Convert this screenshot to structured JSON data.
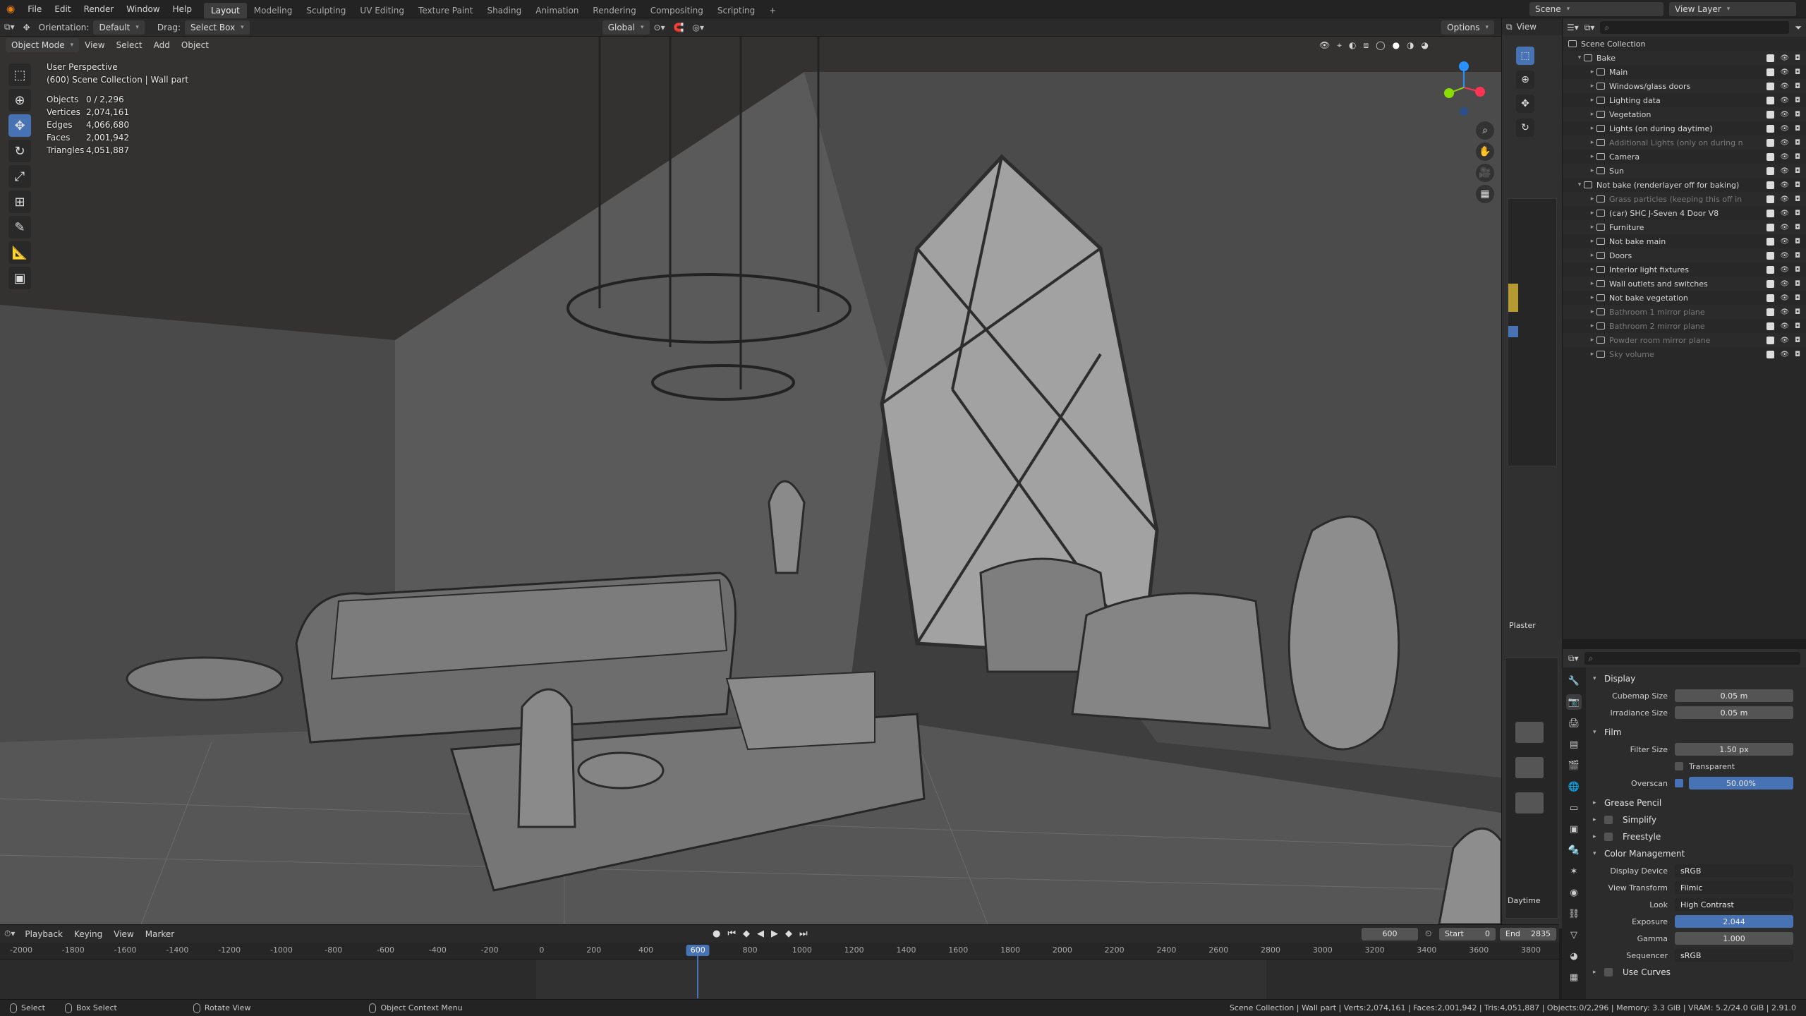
{
  "menubar": {
    "menus": [
      "File",
      "Edit",
      "Render",
      "Window",
      "Help"
    ],
    "workspaces": [
      {
        "label": "Layout",
        "active": true
      },
      {
        "label": "Modeling"
      },
      {
        "label": "Sculpting"
      },
      {
        "label": "UV Editing"
      },
      {
        "label": "Texture Paint"
      },
      {
        "label": "Shading"
      },
      {
        "label": "Animation"
      },
      {
        "label": "Rendering"
      },
      {
        "label": "Compositing"
      },
      {
        "label": "Scripting"
      }
    ],
    "add_workspace": "+",
    "scene": "Scene",
    "view_layer": "View Layer"
  },
  "viewport_header": {
    "orientation_label": "Orientation:",
    "orientation_value": "Default",
    "drag_label": "Drag:",
    "drag_value": "Select Box",
    "transform_orientation": "Global",
    "options": "Options",
    "mode": "Object Mode",
    "menus": [
      "View",
      "Select",
      "Add",
      "Object"
    ]
  },
  "viewport": {
    "perspective": "User Perspective",
    "collection_path": "(600) Scene Collection | Wall part",
    "stats": [
      {
        "label": "Objects",
        "value": "0 / 2,296"
      },
      {
        "label": "Vertices",
        "value": "2,074,161"
      },
      {
        "label": "Edges",
        "value": "4,066,680"
      },
      {
        "label": "Faces",
        "value": "2,001,942"
      },
      {
        "label": "Triangles",
        "value": "4,051,887"
      }
    ]
  },
  "outliner": {
    "header_view": "View",
    "root": "Scene Collection",
    "rows": [
      {
        "label": "Bake",
        "depth": 1,
        "dim": false
      },
      {
        "label": "Main",
        "depth": 2,
        "dim": false
      },
      {
        "label": "Windows/glass doors",
        "depth": 2,
        "dim": false
      },
      {
        "label": "Lighting data",
        "depth": 2,
        "dim": false
      },
      {
        "label": "Vegetation",
        "depth": 2,
        "dim": false
      },
      {
        "label": "Lights (on during daytime)",
        "depth": 2,
        "dim": false
      },
      {
        "label": "Additional Lights (only on during n",
        "depth": 2,
        "dim": true
      },
      {
        "label": "Camera",
        "depth": 2,
        "dim": false
      },
      {
        "label": "Sun",
        "depth": 2,
        "dim": false
      },
      {
        "label": "Not bake (renderlayer off for baking)",
        "depth": 1,
        "dim": false
      },
      {
        "label": "Grass particles (keeping this off in",
        "depth": 2,
        "dim": true
      },
      {
        "label": "(car) SHC J-Seven 4 Door V8",
        "depth": 2,
        "dim": false
      },
      {
        "label": "Furniture",
        "depth": 2,
        "dim": false
      },
      {
        "label": "Not bake main",
        "depth": 2,
        "dim": false
      },
      {
        "label": "Doors",
        "depth": 2,
        "dim": false
      },
      {
        "label": "Interior light fixtures",
        "depth": 2,
        "dim": false
      },
      {
        "label": "Wall outlets and switches",
        "depth": 2,
        "dim": false
      },
      {
        "label": "Not bake vegetation",
        "depth": 2,
        "dim": false
      },
      {
        "label": "Bathroom 1 mirror plane",
        "depth": 2,
        "dim": true
      },
      {
        "label": "Bathroom 2 mirror plane",
        "depth": 2,
        "dim": true
      },
      {
        "label": "Powder room mirror plane",
        "depth": 2,
        "dim": true
      },
      {
        "label": "Sky volume",
        "depth": 2,
        "dim": true
      }
    ]
  },
  "node_panel": {
    "label_top": "Plaster",
    "label_bottom": "Daytime"
  },
  "properties": {
    "display_section": "Display",
    "cubemap_size": {
      "label": "Cubemap Size",
      "value": "0.05 m"
    },
    "irradiance_size": {
      "label": "Irradiance Size",
      "value": "0.05 m"
    },
    "film_section": "Film",
    "filter_size": {
      "label": "Filter Size",
      "value": "1.50 px"
    },
    "transparent": {
      "label": "Transparent",
      "checked": false
    },
    "overscan": {
      "label": "Overscan",
      "value": "50.00%",
      "checked": true
    },
    "grease_pencil": "Grease Pencil",
    "simplify": "Simplify",
    "freestyle": "Freestyle",
    "color_management": "Color Management",
    "display_device": {
      "label": "Display Device",
      "value": "sRGB"
    },
    "view_transform": {
      "label": "View Transform",
      "value": "Filmic"
    },
    "look": {
      "label": "Look",
      "value": "High Contrast"
    },
    "exposure": {
      "label": "Exposure",
      "value": "2.044"
    },
    "gamma": {
      "label": "Gamma",
      "value": "1.000"
    },
    "sequencer": {
      "label": "Sequencer",
      "value": "sRGB"
    },
    "use_curves": "Use Curves"
  },
  "timeline": {
    "menus": [
      "Playback",
      "Keying",
      "View",
      "Marker"
    ],
    "current_frame": "600",
    "start_label": "Start",
    "start_value": "0",
    "end_label": "End",
    "end_value": "2835",
    "ticks": [
      "-2000",
      "-1800",
      "-1600",
      "-1400",
      "-1200",
      "-1000",
      "-800",
      "-600",
      "-400",
      "-200",
      "0",
      "200",
      "400",
      "600",
      "800",
      "1000",
      "1200",
      "1400",
      "1600",
      "1800",
      "2000",
      "2200",
      "2400",
      "2600",
      "2800",
      "3000",
      "3200",
      "3400",
      "3600",
      "3800"
    ]
  },
  "statusbar": {
    "select": "Select",
    "box_select": "Box Select",
    "rotate_view": "Rotate View",
    "context_menu": "Object Context Menu",
    "info": "Scene Collection | Wall part | Verts:2,074,161 | Faces:2,001,942 | Tris:4,051,887 | Objects:0/2,296 | Memory: 3.3 GiB | VRAM: 5.2/24.0 GiB | 2.91.0"
  },
  "colors": {
    "accent": "#4772b3",
    "filter_orange": "#e59b3f"
  }
}
